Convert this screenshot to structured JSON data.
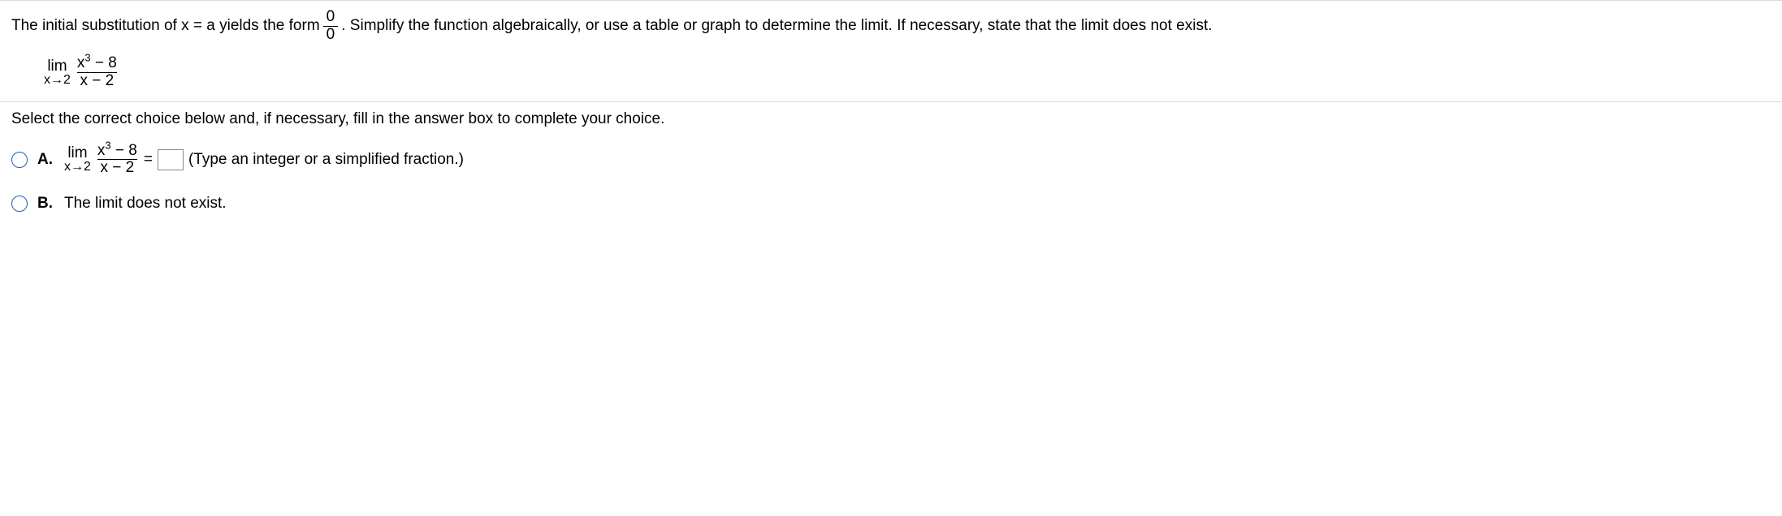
{
  "problem": {
    "text_before_frac": "The initial substitution of x = a yields the form ",
    "frac_num": "0",
    "frac_den": "0",
    "text_after_frac": ". Simplify the function algebraically, or use a table or graph to determine the limit. If necessary, state that the limit does not exist.",
    "limit": {
      "lim_label": "lim",
      "approach": "x→2",
      "numerator_pre": "x",
      "numerator_exp": "3",
      "numerator_post": " − 8",
      "denominator": "x − 2"
    }
  },
  "prompt": "Select the correct choice below and, if necessary, fill in the answer box to complete your choice.",
  "choices": {
    "a": {
      "letter": "A.",
      "limit": {
        "lim_label": "lim",
        "approach": "x→2",
        "numerator_pre": "x",
        "numerator_exp": "3",
        "numerator_post": " − 8",
        "denominator": "x − 2"
      },
      "equals": " = ",
      "hint": "(Type an integer or a simplified fraction.)"
    },
    "b": {
      "letter": "B.",
      "text": "The limit does not exist."
    }
  }
}
